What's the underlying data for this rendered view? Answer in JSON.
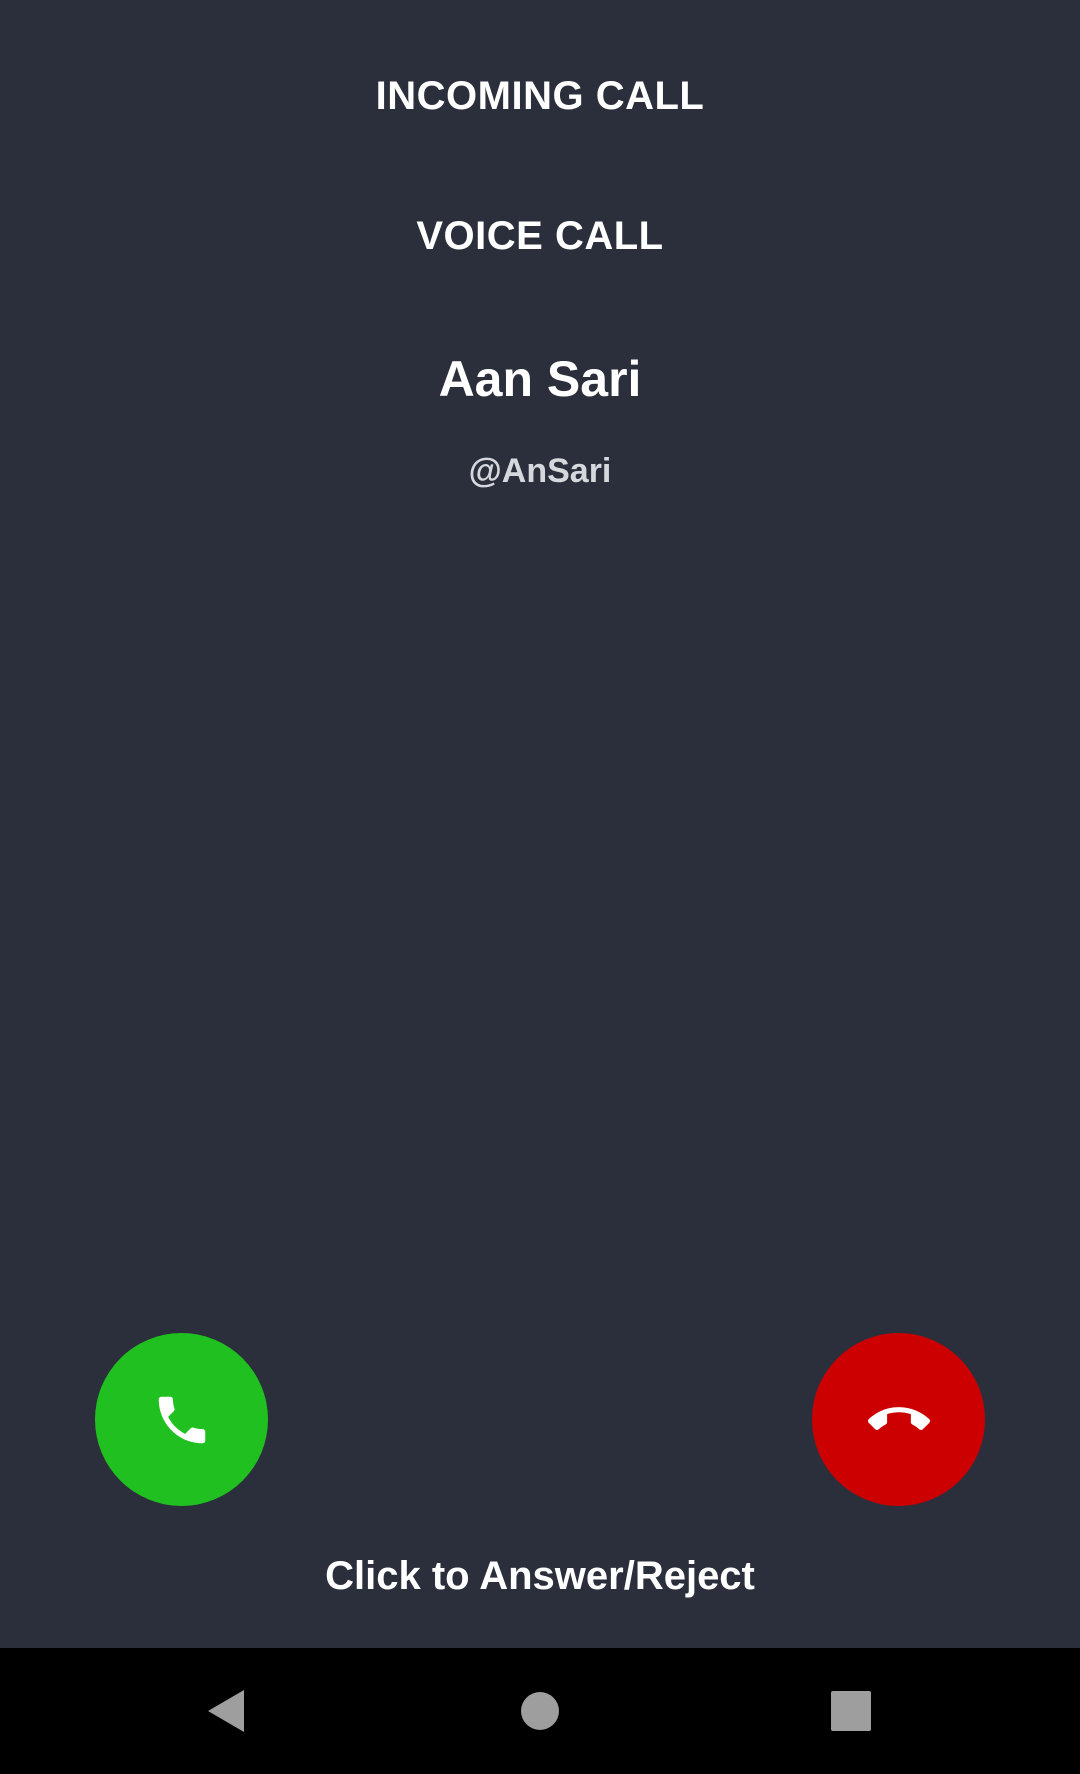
{
  "call": {
    "status": "INCOMING CALL",
    "type": "VOICE CALL",
    "caller_name": "Aan Sari",
    "caller_handle": "@AnSari",
    "hint": "Click to Answer/Reject"
  },
  "buttons": {
    "answer_icon": "phone-icon",
    "reject_icon": "hang-up-icon",
    "answer_color": "#20c020",
    "reject_color": "#cc0000"
  },
  "navbar": {
    "items": [
      "back-icon",
      "home-icon",
      "recents-icon"
    ]
  },
  "colors": {
    "background": "#2a2f3b",
    "navbar": "#000000",
    "nav_icon": "#9e9e9e"
  }
}
